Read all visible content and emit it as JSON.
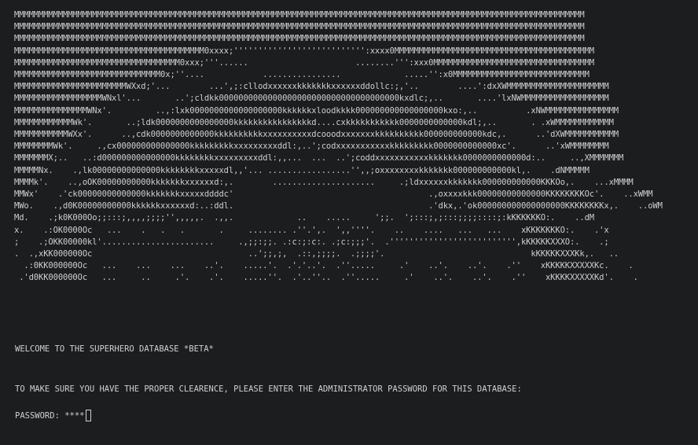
{
  "banner": {
    "ascii_lines": [
      "MMMMMMMMMMMMMMMMMMMMMMMMMMMMMMMMMMMMMMMMMMMMMMMMMMMMMMMMMMMMMMMMMMMMMMMMMMMMMMMMMMMMMMMMMMMMMMMMMMMMMMMMMMMMMMMMMMMMM",
      "MMMMMMMMMMMMMMMMMMMMMMMMMMMMMMMMMMMMMMMMMMMMMMMMMMMMMMMMMMMMMMMMMMMMMMMMMMMMMMMMMMMMMMMMMMMMMMMMMMMMMMMMMMMMMMMMMMMMM",
      "MMMMMMMMMMMMMMMMMMMMMMMMMMMMMMMMMMMMMMMMMMMMMMMMMMMMMMMMMMMMMMMMMMMMMMMMMMMMMMMMMMMMMMMMMMMMMMMMMMMMMMMMMMMMMMMMMMMMM",
      "MMMMMMMMMMMMMMMMMMMMMMMMMMMMMMMMMMMMMMM0xxxx;''''''''''''''''''''''''''':xxxx0MMMMMMMMMMMMMMMMMMMMMMMMMMMMMMMMMMMMMMMMM",
      "MMMMMMMMMMMMMMMMMMMMMMMMMMMMMMMMMM0xxx;'''......                      ........''':xxx0MMMMMMMMMMMMMMMMMMMMMMMMMMMMMMMMM",
      "MMMMMMMMMMMMMMMMMMMMMMMMMMMMMM0x;''....            ................             .....'':x0MMMMMMMMMMMMMMMMMMMMMMMMMMMM",
      "MMMMMMMMMMMMMMMMMMMMMMMWXxd;'...        ...',;:cllodxxxxxxkkkkkkkxxxxxxddollc:;,'..        ....':dxXWMMMMMMMMMMMMMMMMMMMMM",
      "MMMMMMMMMMMMMMMMMMWNxl'...       ..';cldkk0000000000000000000000000000000000000kxdlc;,..       ....'lxNWMMMMMMMMMMMMMMMMMM",
      "MMMMMMMMMMMMMMMWNx'.         ..,:lxk0000000000000000000kkkkkkxloodkkkk000000000000000000kxo:,..          .xNWMMMMMMMMMMMMMMM",
      "MMMMMMMMMMMMWk'.       ..;ldk0000000000000000kkkkkkkkkkkkkkkkd....cxkkkkkkkkkkk0000000000000kdl;,..       . .xWMMMMMMMMMMMM",
      "MMMMMMMMMMMWXx'.      ..,cdk0000000000000kkkkkkkkkkxxxxxxxxxxdcooodxxxxxxxkkkkkkkkkk000000000000kdc,.      ..'dXWMMMMMMMMMMM",
      "MMMMMMMMWk'.     .,cx000000000000000kkkkkkkkkxxxxxxxxxddl:,..';codxxxxxxxxxxxkkkkkkkkk0000000000000xc'.      ..'xWMMMMMMMM",
      "MMMMMMMX;..   ..:d000000000000000kkkkkkkkxxxxxxxxxddl:,,...  ...  ..';coddxxxxxxxxxxxkkkkkkk0000000000000d:..     ..,XMMMMMMM",
      "MMMMMNx.    .,lk00000000000000kkkkkkkkxxxxxdl,,'... .................'',,;oxxxxxxxxkkkkkkk000000000000kl,.    .dNMMMMM",
      "MMMMk'.    ..,oOK00000000000kkkkkkkxxxxxxd:,.        .....................     .;ldxxxxxxkkkkkkk000000000000KKKOo,.    ...xMMMM",
      "MMWx'    .'ck00000000000000kkkkkkkxxxxxddddc'                                        .,oxxxxkkk00000000000000KKKKKKKKOc'.    ..xWMM",
      "MWo.    .,d0K00000000000kkkkkkxxxxxxd:..:ddl.                                        .'dkx,.'ok000000000000000000KKKKKKKKx,.    ..oWM",
      "Md.    .;k0K000Oo;;:::;,,,,;;;;'',,,,,.  .,,.             ..    .....     ';;.  ';:::;,;:::;;;;::::;:kKKKKKKO:.    ..dM",
      "x.    .:OK0000Oc   ...    .   .   .       .     ........ .''.',.  ',,''''.    ..    ....   ...   ...    xKKKKKKKO:.    .'x",
      ";    .;OKK00000kl'.......................     .,;;:;;. .:c:;:c:. .;c:;;;'.  .'''''''''''''''''''''''''',kKKKKKXXXO:.    .;",
      ".  .,xKK000000Oc                                ..';;,;,  .::,;;;;.  .;;;;'.                              kKKKKKXXXKk,.   ..",
      "  .:0KK000000Oc   ...    ...    ...    ..'.    .....'.  .'.'..'.  .''.....     .'    ..'.    ..'.    .''    xKKKKKXXXXXKc.    .",
      " .'d0KK000000Oc   ...     ..     .'.    .'.    .....''.  .'..''..  .''.....     .'    ..'.    ..'.    .''    xKKKKXXXXXKd'.    ."
    ]
  },
  "messages": {
    "welcome": "WELCOME TO THE SUPERHERO DATABASE *BETA*",
    "instruction": "TO MAKE SURE YOU HAVE THE PROPER CLEARENCE, PLEASE ENTER THE ADMINISTRATOR PASSWORD FOR THIS DATABASE:"
  },
  "password_prompt": {
    "label": "PASSWORD: ",
    "value": "****"
  }
}
